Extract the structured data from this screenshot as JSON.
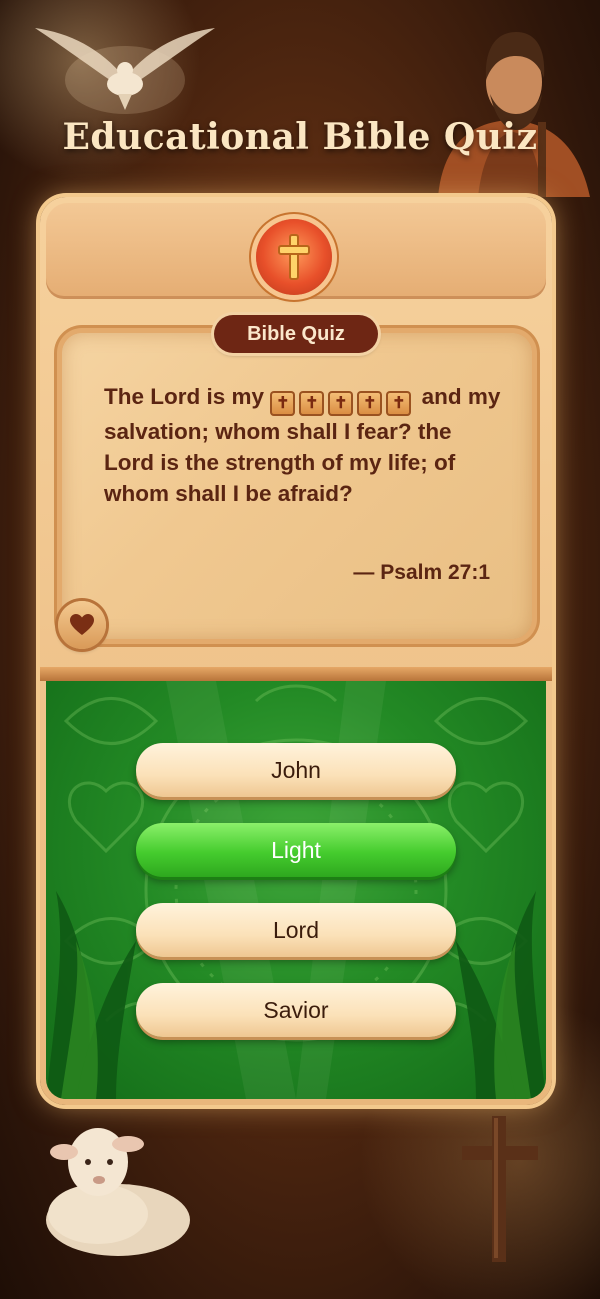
{
  "app": {
    "title": "Educational Bible Quiz"
  },
  "quiz": {
    "badge_label": "Bible Quiz",
    "verse_before": "The Lord is my",
    "verse_after": "and my salvation; whom shall I fear? the Lord is the strength of my life; of whom shall I be afraid?",
    "blank_glyph": "✝",
    "blank_letters": 5,
    "reference": "— Psalm 27:1"
  },
  "answers": [
    {
      "label": "John",
      "state": "default"
    },
    {
      "label": "Light",
      "state": "correct"
    },
    {
      "label": "Lord",
      "state": "default"
    },
    {
      "label": "Savior",
      "state": "default"
    }
  ],
  "icons": {
    "header_emblem": "cross-icon",
    "favorite": "heart-icon"
  },
  "colors": {
    "title_text": "#fbe6c2",
    "verse_text": "#5b2512",
    "badge_bg": "#6e2614",
    "correct_answer": "#45cc2e",
    "answer_bg": "#fbe1b8",
    "panel_green": "#238a25"
  }
}
